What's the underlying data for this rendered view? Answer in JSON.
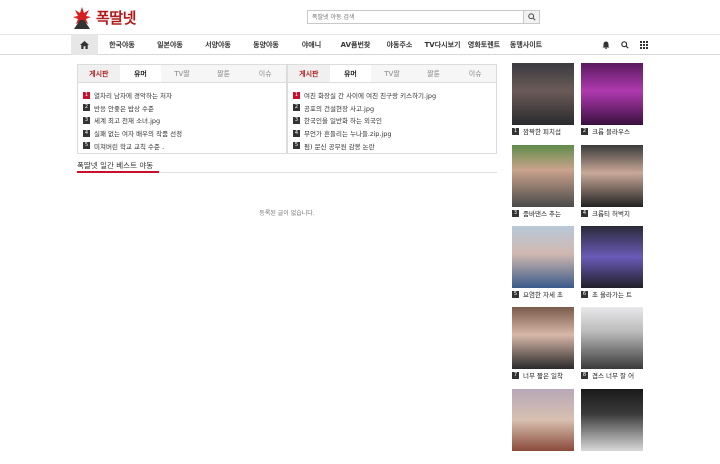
{
  "header": {
    "logo_text": "폭딸넷",
    "search_placeholder": "폭딸넷 야동 검색"
  },
  "nav": {
    "items": [
      "한국야동",
      "일본야동",
      "서양야동",
      "동양야동",
      "야애니",
      "AV품번찾",
      "야동주소",
      "TV다시보기",
      "영화토렌트",
      "동맹사이트"
    ]
  },
  "left_box": {
    "label": "게시판",
    "tabs": [
      "유머",
      "TV짤",
      "짤툰",
      "이슈"
    ],
    "items": [
      "열차리 남자에 경악하는 처자",
      "반응 안좋은 밥상 수준",
      "세계 최고 천재 소녀.jpg",
      "실패 없는 여자 배우의 작품 선정",
      "미쳐버린 학교 교칙 수준 ."
    ]
  },
  "right_box": {
    "label": "게시판",
    "tabs": [
      "유머",
      "TV짤",
      "짤툰",
      "이슈"
    ],
    "items": [
      "여친 화장실 간 사이에 여친 친구랑 키스하기.jpg",
      "공포의 건설현장 사고.jpg",
      "한국인을 일반화 하는 외국인",
      "무언가 흔들리는 누나들.zip.jpg",
      "펌) 문신 공무원 감봉 논란"
    ]
  },
  "best": {
    "title": "폭딸넷 일간 베스트 야동",
    "empty": "등록된 글이 없습니다."
  },
  "thumbs": [
    {
      "n": "1",
      "title": "깜짝한 피치섭"
    },
    {
      "n": "2",
      "title": "크롭 블라우스"
    },
    {
      "n": "3",
      "title": "줌바댄스 추는"
    },
    {
      "n": "4",
      "title": "크롭티 허벅지"
    },
    {
      "n": "5",
      "title": "요염한 자세 초"
    },
    {
      "n": "6",
      "title": "초 올라가는 트"
    },
    {
      "n": "7",
      "title": "너무 짧은 일착"
    },
    {
      "n": "8",
      "title": "겹스 너무 잘 어"
    }
  ],
  "colors": {
    "accent": "#c8102e",
    "brand": "#b01c1c"
  }
}
